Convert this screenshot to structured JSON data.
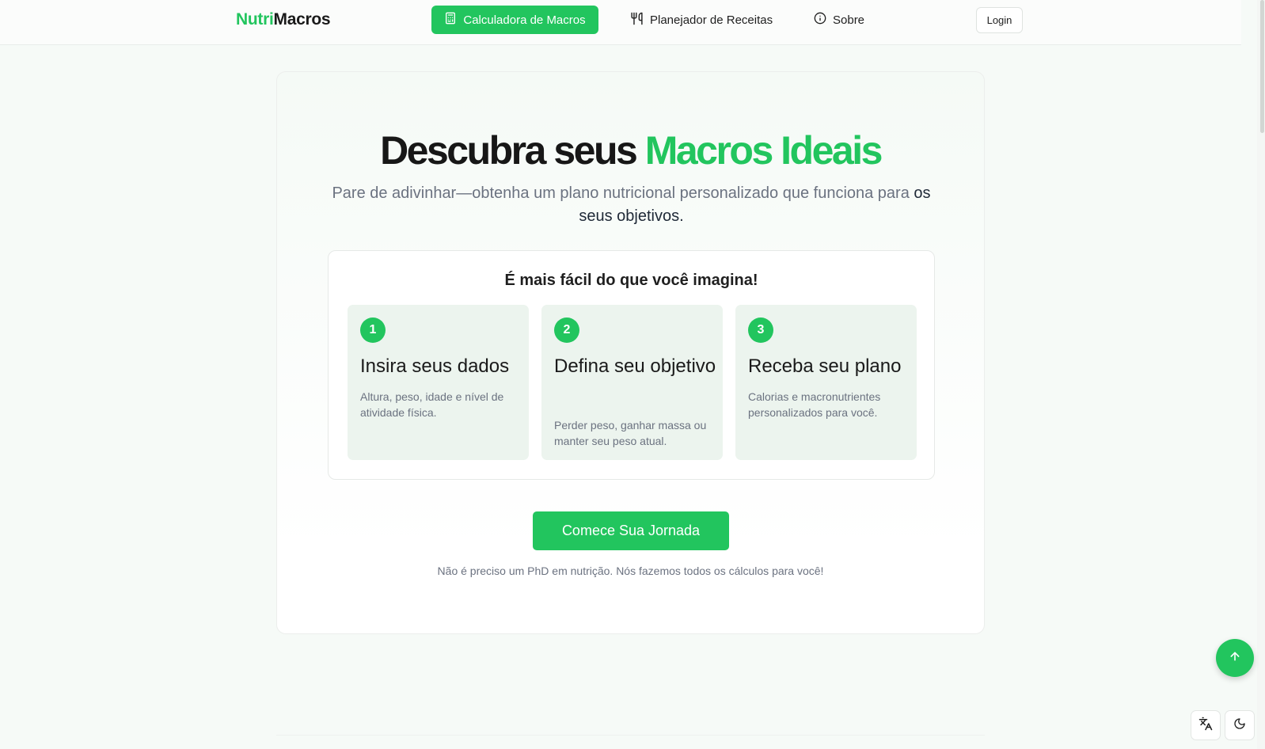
{
  "nav": {
    "logo_prefix": "Nutri",
    "logo_suffix": "Macros",
    "items": [
      {
        "label": "Calculadora de Macros",
        "icon": "calculator-icon",
        "active": true
      },
      {
        "label": "Planejador de Receitas",
        "icon": "utensils-icon",
        "active": false
      },
      {
        "label": "Sobre",
        "icon": "info-icon",
        "active": false
      }
    ],
    "login_label": "Login"
  },
  "hero": {
    "title_part1": "Descubra seus ",
    "title_accent": "Macros Ideais",
    "subtitle_part1": "Pare de adivinhar—obtenha um plano nutricional personalizado que funciona para ",
    "subtitle_part2": "os seus objetivos."
  },
  "steps": {
    "title": "É mais fácil do que você imagina!",
    "items": [
      {
        "number": "1",
        "title": "Insira seus dados",
        "description": "Altura, peso, idade e nível de atividade física."
      },
      {
        "number": "2",
        "title": "Defina seu objetivo",
        "description": "Perder peso, ganhar massa ou manter seu peso atual."
      },
      {
        "number": "3",
        "title": "Receba seu plano",
        "description": "Calorias e macronutrientes personalizados para você."
      }
    ]
  },
  "cta": {
    "button_label": "Comece Sua Jornada",
    "note": "Não é preciso um PhD em nutrição. Nós fazemos todos os cálculos para você!"
  },
  "floating": {
    "scroll_top_icon": "arrow-up-icon",
    "language_icon": "translate-icon",
    "theme_icon": "moon-icon"
  },
  "colors": {
    "accent": "#22c55e",
    "text": "#171717",
    "muted": "#6b7280",
    "step_bg": "#ecf4ee"
  }
}
